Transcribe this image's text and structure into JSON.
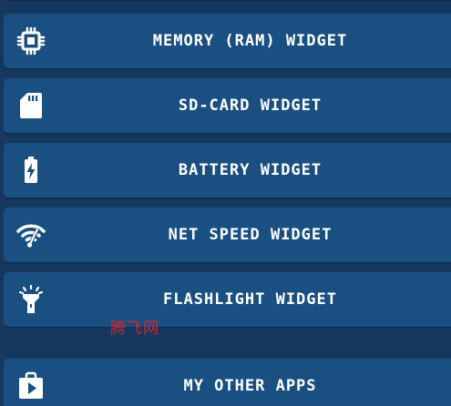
{
  "menu": {
    "items": [
      {
        "label": "MEMORY (RAM) WIDGET",
        "icon": "chip-icon"
      },
      {
        "label": "SD-CARD WIDGET",
        "icon": "sd-card-icon"
      },
      {
        "label": "BATTERY WIDGET",
        "icon": "battery-icon"
      },
      {
        "label": "NET SPEED WIDGET",
        "icon": "wifi-speed-icon"
      },
      {
        "label": "FLASHLIGHT WIDGET",
        "icon": "flashlight-icon"
      },
      {
        "label": "MY OTHER APPS",
        "icon": "store-bag-icon"
      }
    ]
  },
  "watermark": {
    "text": "腾飞网"
  },
  "colors": {
    "background": "#16385e",
    "button": "#1a4f81",
    "text": "#ffffff",
    "watermark": "#d6262c"
  }
}
